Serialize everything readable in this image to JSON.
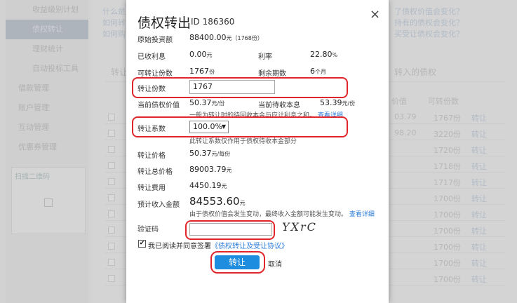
{
  "dialog": {
    "title": "债权转出",
    "id_text": "ID 186360",
    "close": "×",
    "fields": {
      "principal": {
        "label": "原始投资额",
        "value": "88400.00",
        "unit": "元（1768份）"
      },
      "received_interest": {
        "label": "已收利息",
        "value": "0.00",
        "unit": "元"
      },
      "rate": {
        "label": "利率",
        "value": "22.80",
        "unit": "%"
      },
      "transferable_shares": {
        "label": "可转让份数",
        "value": "1767",
        "unit": "份"
      },
      "remaining_periods": {
        "label": "剩余期数",
        "value": "6",
        "unit": "个月"
      },
      "transfer_shares": {
        "label": "转让份数",
        "value": "1767"
      },
      "current_value": {
        "label": "当前债权价值",
        "value": "50.37",
        "unit": "元/份"
      },
      "pending_interest": {
        "label": "当前待收本息",
        "value": "53.39",
        "unit": "元/份"
      },
      "value_note": "一般为转让时的待回收本金与应计利息之和。",
      "value_note_link": "查看详细",
      "coefficient": {
        "label": "转让系数",
        "value": "100.0%"
      },
      "coefficient_note": "此转让系数仅作用于债权待收本金部分",
      "price": {
        "label": "转让价格",
        "value": "50.37",
        "unit": "元/每份"
      },
      "total_price": {
        "label": "转让总价格",
        "value": "89003.79",
        "unit": "元"
      },
      "fee": {
        "label": "转让费用",
        "value": "4450.19",
        "unit": "元"
      },
      "expected_income": {
        "label": "预计收入金额",
        "value": "84553.60",
        "unit": "元"
      },
      "income_note": "由于债权价值会发生变动，最终收入金额可能发生变动。",
      "income_note_link": "查看详细",
      "captcha": {
        "label": "验证码",
        "value": "",
        "image_text": "YXrC"
      }
    },
    "agree_text": "我已阅读并同意签署",
    "agree_link": "《债权转让及受让协议》",
    "agree_mark": "✔",
    "submit": "转让",
    "cancel": "取消"
  },
  "background": {
    "sidebar": {
      "items": [
        "收益级别计划",
        "债权转让",
        "理财统计",
        "自动投标工具"
      ],
      "sections": [
        "借款管理",
        "账户管理",
        "互动管理",
        "优惠券管理"
      ],
      "box_title": "扫描二维码"
    },
    "top_links": [
      "什么是",
      "如何转",
      "如何购",
      "了债权价值会变化？",
      "持有的债权会变化？",
      "买受让债权会变化？"
    ],
    "tabs": [
      "转让",
      "转入的债权"
    ],
    "col_headers": [
      "价值",
      "可转份数"
    ],
    "values": [
      "03.79",
      "98.20",
      "",
      "",
      "",
      ""
    ],
    "shares": [
      "1767份",
      "3220份",
      "1720份",
      "1718份",
      "1717份",
      "1700份",
      "1700份",
      "1700份",
      "1700份",
      "1700份",
      "1700份"
    ],
    "action": "转让"
  }
}
